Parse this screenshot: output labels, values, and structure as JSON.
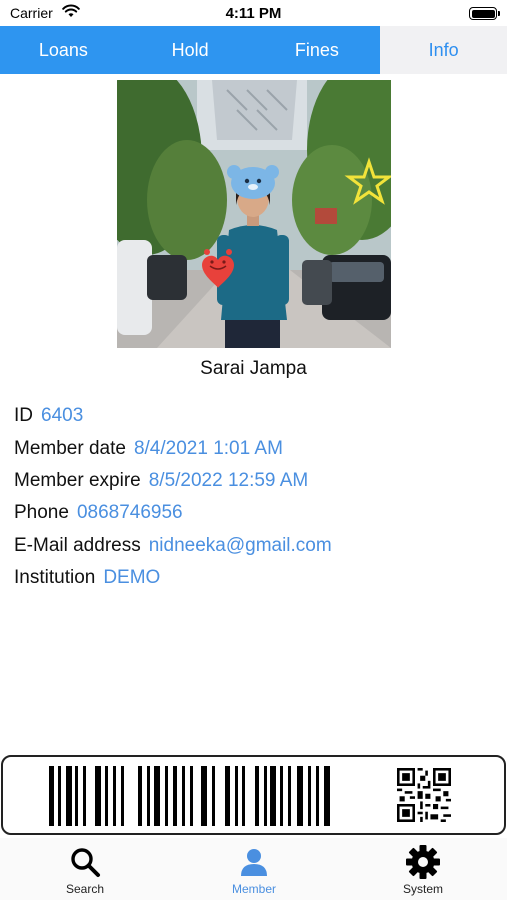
{
  "status_bar": {
    "carrier": "Carrier",
    "time": "4:11 PM"
  },
  "tabs": [
    {
      "label": "Loans",
      "active": false
    },
    {
      "label": "Hold",
      "active": false
    },
    {
      "label": "Fines",
      "active": false
    },
    {
      "label": "Info",
      "active": true
    }
  ],
  "member": {
    "name": "Sarai Jampa",
    "fields": [
      {
        "label": "ID",
        "value": "6403"
      },
      {
        "label": "Member date",
        "value": "8/4/2021 1:01 AM"
      },
      {
        "label": "Member expire",
        "value": "8/5/2022 12:59 AM"
      },
      {
        "label": "Phone",
        "value": "0868746956"
      },
      {
        "label": "E-Mail address",
        "value": "nidneeka@gmail.com"
      },
      {
        "label": "Institution",
        "value": "DEMO"
      }
    ]
  },
  "bottom_nav": {
    "items": [
      {
        "label": "Search",
        "icon": "search-icon",
        "active": false
      },
      {
        "label": "Member",
        "icon": "person-icon",
        "active": true
      },
      {
        "label": "System",
        "icon": "gear-icon",
        "active": false
      }
    ]
  },
  "colors": {
    "tab_bar": "#2e95f0",
    "active_tab_bg": "#f1f1f3",
    "link_blue": "#4a8fe0"
  }
}
